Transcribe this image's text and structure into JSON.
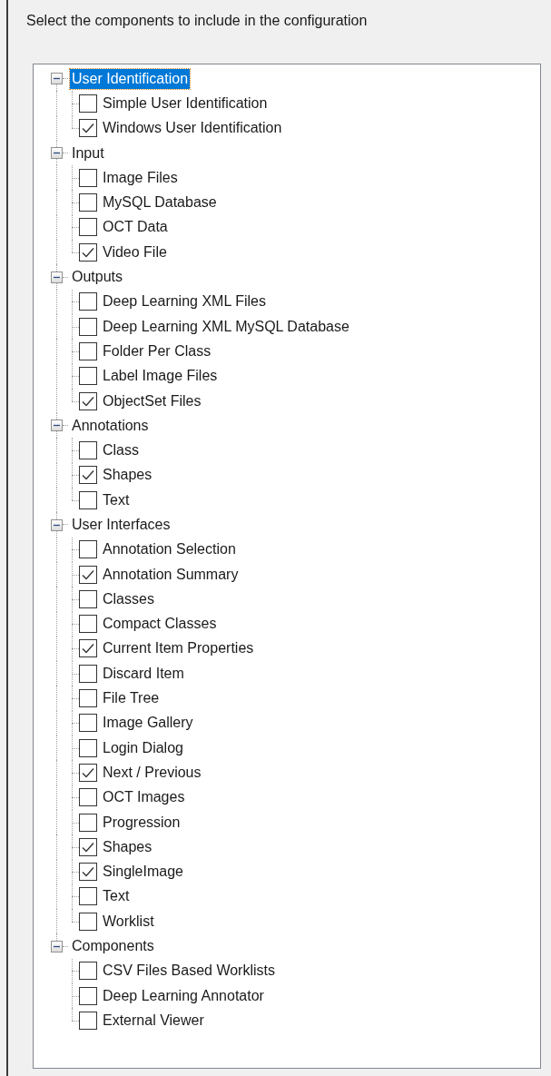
{
  "instruction": "Select the components to include in the configuration",
  "tree": {
    "groups": [
      {
        "label": "User Identification",
        "expanded": true,
        "selected": true,
        "children": [
          {
            "label": "Simple User Identification",
            "checked": false
          },
          {
            "label": "Windows User Identification",
            "checked": true
          }
        ]
      },
      {
        "label": "Input",
        "expanded": true,
        "selected": false,
        "children": [
          {
            "label": "Image Files",
            "checked": false
          },
          {
            "label": "MySQL Database",
            "checked": false
          },
          {
            "label": "OCT Data",
            "checked": false
          },
          {
            "label": "Video File",
            "checked": true
          }
        ]
      },
      {
        "label": "Outputs",
        "expanded": true,
        "selected": false,
        "children": [
          {
            "label": "Deep Learning XML Files",
            "checked": false
          },
          {
            "label": "Deep Learning XML MySQL Database",
            "checked": false
          },
          {
            "label": "Folder Per Class",
            "checked": false
          },
          {
            "label": "Label Image Files",
            "checked": false
          },
          {
            "label": "ObjectSet Files",
            "checked": true
          }
        ]
      },
      {
        "label": "Annotations",
        "expanded": true,
        "selected": false,
        "children": [
          {
            "label": "Class",
            "checked": false
          },
          {
            "label": "Shapes",
            "checked": true
          },
          {
            "label": "Text",
            "checked": false
          }
        ]
      },
      {
        "label": "User Interfaces",
        "expanded": true,
        "selected": false,
        "children": [
          {
            "label": "Annotation Selection",
            "checked": false
          },
          {
            "label": "Annotation Summary",
            "checked": true
          },
          {
            "label": "Classes",
            "checked": false
          },
          {
            "label": "Compact Classes",
            "checked": false
          },
          {
            "label": "Current Item Properties",
            "checked": true
          },
          {
            "label": "Discard Item",
            "checked": false
          },
          {
            "label": "File Tree",
            "checked": false
          },
          {
            "label": "Image Gallery",
            "checked": false
          },
          {
            "label": "Login Dialog",
            "checked": false
          },
          {
            "label": "Next / Previous",
            "checked": true
          },
          {
            "label": "OCT Images",
            "checked": false
          },
          {
            "label": "Progression",
            "checked": false
          },
          {
            "label": "Shapes",
            "checked": true
          },
          {
            "label": "SingleImage",
            "checked": true
          },
          {
            "label": "Text",
            "checked": false
          },
          {
            "label": "Worklist",
            "checked": false
          }
        ]
      },
      {
        "label": "Components",
        "expanded": true,
        "selected": false,
        "children": [
          {
            "label": "CSV Files Based Worklists",
            "checked": false
          },
          {
            "label": "Deep Learning Annotator",
            "checked": false
          },
          {
            "label": "External Viewer",
            "checked": false
          }
        ]
      }
    ]
  }
}
